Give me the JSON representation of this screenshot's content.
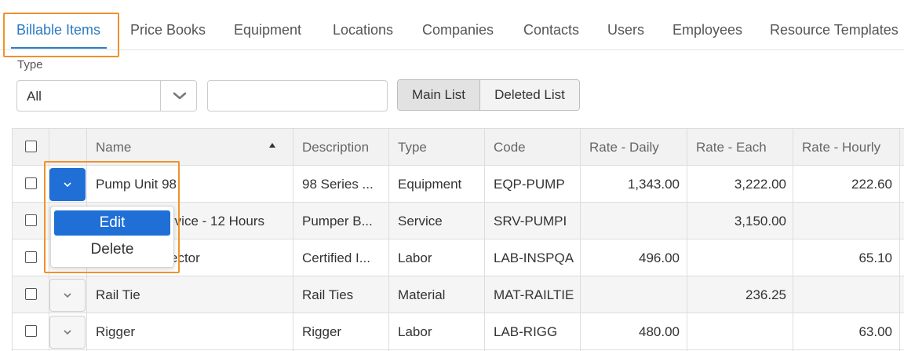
{
  "tabs": [
    {
      "label": "Billable Items",
      "active": true
    },
    {
      "label": "Price Books"
    },
    {
      "label": "Equipment"
    },
    {
      "label": "Locations"
    },
    {
      "label": "Companies"
    },
    {
      "label": "Contacts"
    },
    {
      "label": "Users"
    },
    {
      "label": "Employees"
    },
    {
      "label": "Resource Templates"
    }
  ],
  "filters": {
    "type_label": "Type",
    "type_value": "All",
    "search_value": "",
    "main_list": "Main List",
    "deleted_list": "Deleted List"
  },
  "table": {
    "headers": {
      "name": "Name",
      "description": "Description",
      "type": "Type",
      "code": "Code",
      "rate_daily": "Rate - Daily",
      "rate_each": "Rate - Each",
      "rate_hourly": "Rate - Hourly"
    },
    "sort": "name ascending",
    "rows": [
      {
        "name": "Pump Unit 98",
        "description": "98 Series ...",
        "type": "Equipment",
        "code": "EQP-PUMP",
        "rate_daily": "1,343.00",
        "rate_each": "3,222.00",
        "rate_hourly": "222.60"
      },
      {
        "name": "rvice - 12 Hours",
        "description": "Pumper B...",
        "type": "Service",
        "code": "SRV-PUMPI",
        "rate_daily": "",
        "rate_each": "3,150.00",
        "rate_hourly": ""
      },
      {
        "name": "ector",
        "description": "Certified I...",
        "type": "Labor",
        "code": "LAB-INSPQA",
        "rate_daily": "496.00",
        "rate_each": "",
        "rate_hourly": "65.10"
      },
      {
        "name": "Rail Tie",
        "description": "Rail Ties",
        "type": "Material",
        "code": "MAT-RAILTIE",
        "rate_daily": "",
        "rate_each": "236.25",
        "rate_hourly": ""
      },
      {
        "name": "Rigger",
        "description": "Rigger",
        "type": "Labor",
        "code": "LAB-RIGG",
        "rate_daily": "480.00",
        "rate_each": "",
        "rate_hourly": "63.00"
      }
    ]
  },
  "row_menu": {
    "edit": "Edit",
    "delete": "Delete"
  },
  "colors": {
    "accent": "#2b7bc4",
    "button_blue": "#1f6fd6",
    "highlight": "#f0912c"
  }
}
